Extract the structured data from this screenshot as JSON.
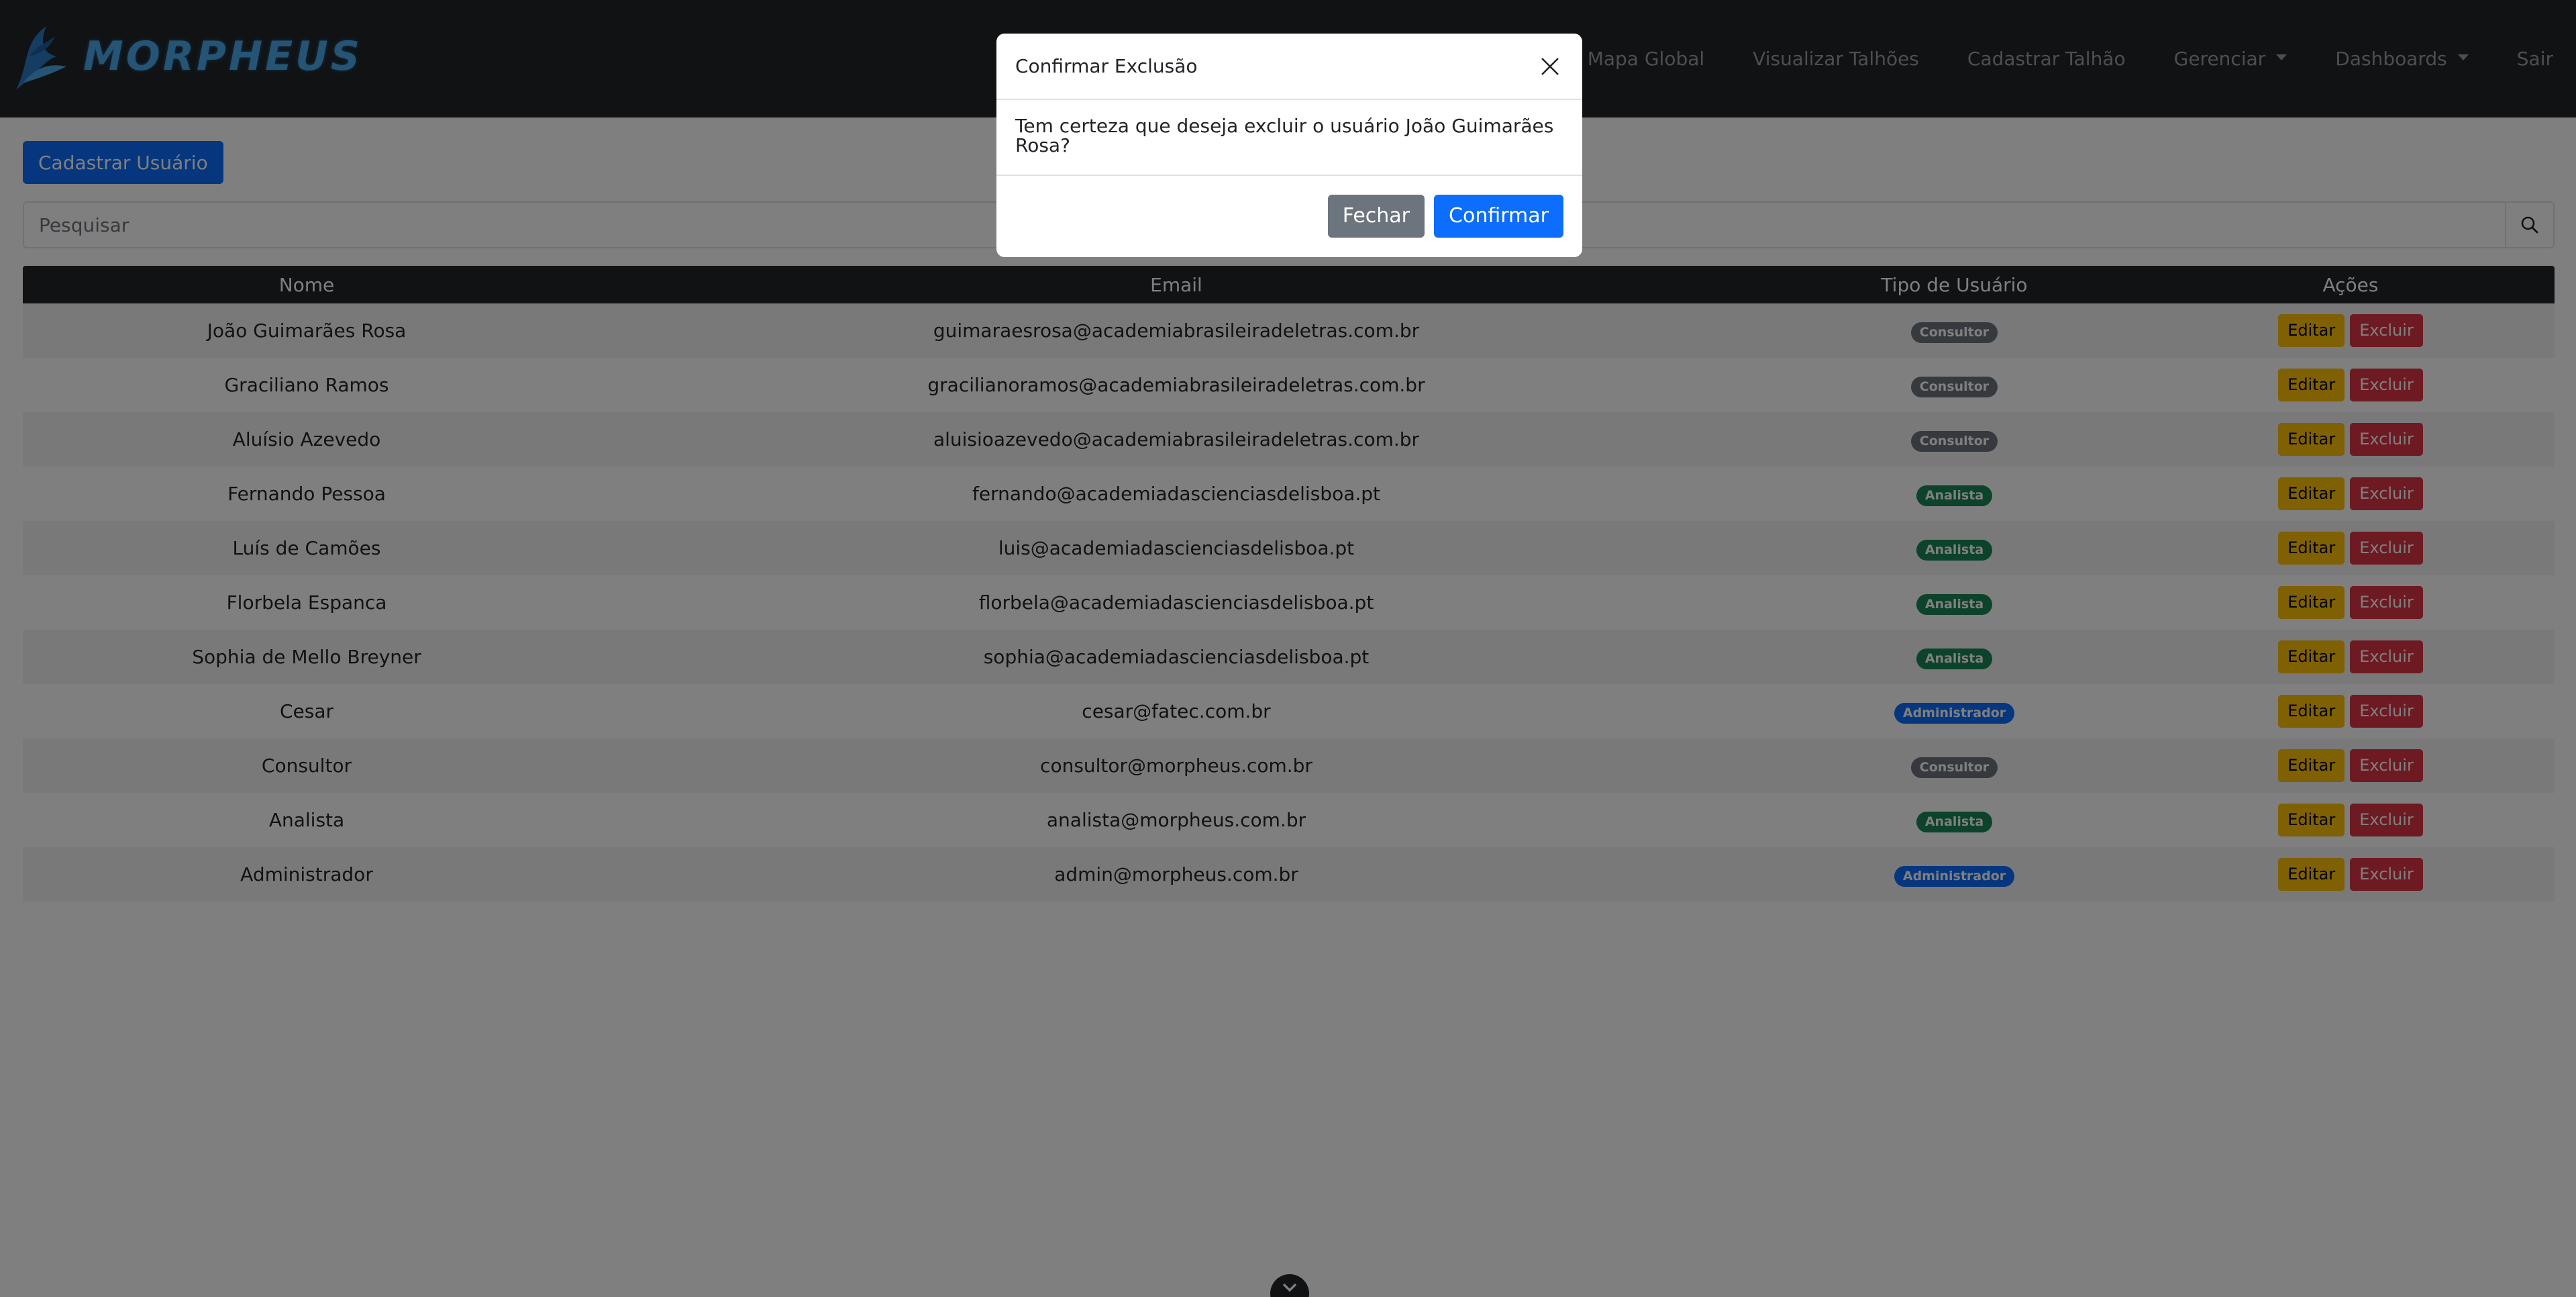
{
  "brand": {
    "logo_text": "MORPHEUS",
    "accent": "#4aa8e8"
  },
  "nav": {
    "items": [
      {
        "label": "Mapa Global",
        "dropdown": false
      },
      {
        "label": "Visualizar Talhões",
        "dropdown": false
      },
      {
        "label": "Cadastrar Talhão",
        "dropdown": false
      },
      {
        "label": "Gerenciar",
        "dropdown": true
      },
      {
        "label": "Dashboards",
        "dropdown": true
      },
      {
        "label": "Sair",
        "dropdown": false
      }
    ]
  },
  "main": {
    "add_button_label": "Cadastrar Usuário",
    "search": {
      "placeholder": "Pesquisar",
      "value": "",
      "icon": "search-icon"
    },
    "table": {
      "headers": [
        "Nome",
        "Email",
        "Tipo de Usuário",
        "Ações"
      ],
      "edit_label": "Editar",
      "delete_label": "Excluir",
      "rows": [
        {
          "nome": "João Guimarães Rosa",
          "email": "guimaraesrosa@academiabrasileiradeletras.com.br",
          "tipo": "Consultor"
        },
        {
          "nome": "Graciliano Ramos",
          "email": "gracilianoramos@academiabrasileiradeletras.com.br",
          "tipo": "Consultor"
        },
        {
          "nome": "Aluísio Azevedo",
          "email": "aluisioazevedo@academiabrasileiradeletras.com.br",
          "tipo": "Consultor"
        },
        {
          "nome": "Fernando Pessoa",
          "email": "fernando@academiadascienciasdelisboa.pt",
          "tipo": "Analista"
        },
        {
          "nome": "Luís de Camões",
          "email": "luis@academiadascienciasdelisboa.pt",
          "tipo": "Analista"
        },
        {
          "nome": "Florbela Espanca",
          "email": "florbela@academiadascienciasdelisboa.pt",
          "tipo": "Analista"
        },
        {
          "nome": "Sophia de Mello Breyner",
          "email": "sophia@academiadascienciasdelisboa.pt",
          "tipo": "Analista"
        },
        {
          "nome": "Cesar",
          "email": "cesar@fatec.com.br",
          "tipo": "Administrador"
        },
        {
          "nome": "Consultor",
          "email": "consultor@morpheus.com.br",
          "tipo": "Consultor"
        },
        {
          "nome": "Analista",
          "email": "analista@morpheus.com.br",
          "tipo": "Analista"
        },
        {
          "nome": "Administrador",
          "email": "admin@morpheus.com.br",
          "tipo": "Administrador"
        }
      ]
    }
  },
  "modal": {
    "title": "Confirmar Exclusão",
    "message": "Tem certeza que deseja excluir o usuário João Guimarães Rosa?",
    "close_label": "Fechar",
    "confirm_label": "Confirmar"
  },
  "colors": {
    "navbar": "#212529",
    "primary": "#0d6efd",
    "secondary": "#6c757d",
    "success": "#198754",
    "warning": "#ffc107",
    "danger": "#dc3545"
  }
}
